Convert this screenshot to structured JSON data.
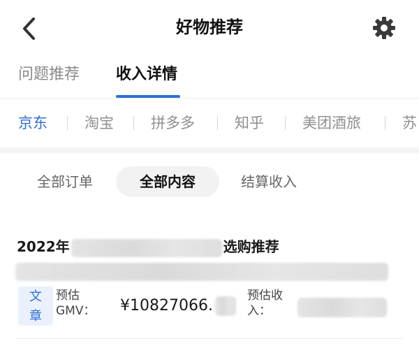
{
  "header": {
    "title": "好物推荐",
    "back_icon": "chevron-left-icon",
    "settings_icon": "gear-icon"
  },
  "tabs": [
    {
      "label": "问题推荐",
      "active": false
    },
    {
      "label": "收入详情",
      "active": true
    }
  ],
  "platforms": [
    {
      "label": "京东",
      "active": true
    },
    {
      "label": "淘宝",
      "active": false
    },
    {
      "label": "拼多多",
      "active": false
    },
    {
      "label": "知乎",
      "active": false
    },
    {
      "label": "美团酒旅",
      "active": false
    },
    {
      "label": "苏",
      "active": false
    }
  ],
  "filters": [
    {
      "label": "全部订单",
      "active": false
    },
    {
      "label": "全部内容",
      "active": true
    },
    {
      "label": "结算收入",
      "active": false
    }
  ],
  "card": {
    "title_prefix": "2022年",
    "title_suffix": "选购推荐",
    "tag_line1": "文",
    "tag_line2": "章",
    "gmv_label_line1": "预估",
    "gmv_label_line2": "GMV：",
    "gmv_value": "¥10827066.",
    "income_label_line1": "预估收",
    "income_label_line2": "入："
  },
  "colors": {
    "accent": "#2f6fd6",
    "text": "#1a1a1a",
    "muted": "#8f8f8f"
  }
}
